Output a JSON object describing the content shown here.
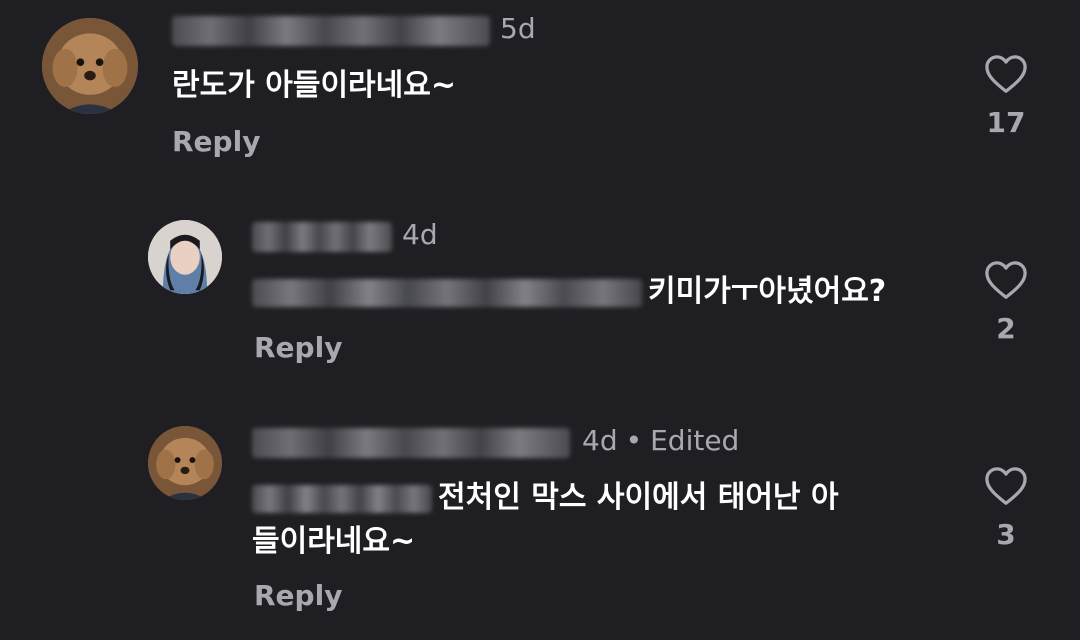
{
  "comments": [
    {
      "avatar": "dog-avatar",
      "username_hidden": true,
      "time": "5d",
      "edited": "",
      "text": "란도가 아들이라네요~",
      "reply_label": "Reply",
      "likes": "17",
      "like_icon": "heart-outline-icon"
    },
    {
      "avatar": "woman-avatar",
      "username_hidden": true,
      "time": "4d",
      "edited": "",
      "text_mention_hidden": true,
      "text": "키미가ㅜ아녔어요?",
      "reply_label": "Reply",
      "likes": "2",
      "like_icon": "heart-outline-icon"
    },
    {
      "avatar": "dog-avatar",
      "username_hidden": true,
      "time": "4d",
      "edited": "Edited",
      "text_mention_hidden": true,
      "text_line1": "전처인 막스 사이에서 태어난 아",
      "text_line2": "들이라네요~",
      "reply_label": "Reply",
      "likes": "3",
      "like_icon": "heart-outline-icon"
    }
  ],
  "colors": {
    "background": "#1f1f23",
    "text_primary": "#ffffff",
    "text_secondary": "#a8a8ae"
  }
}
